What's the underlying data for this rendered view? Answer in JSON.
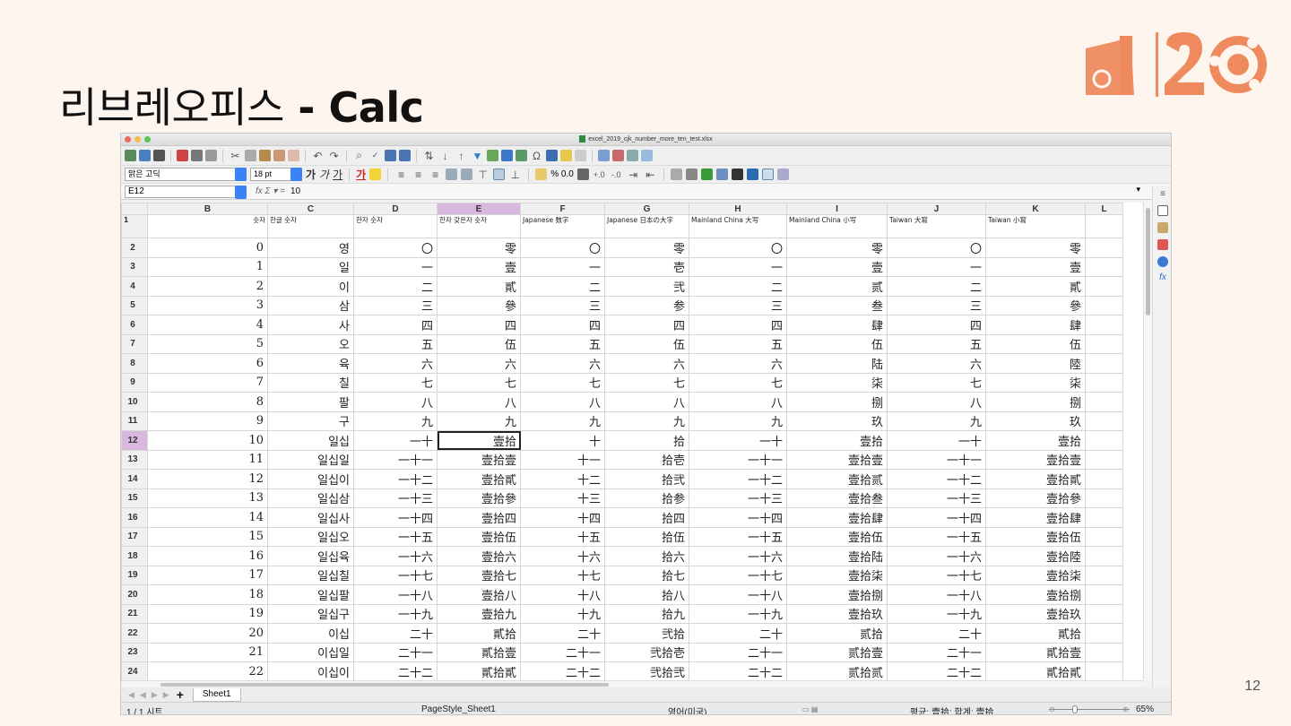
{
  "slide": {
    "title_korean": "리브레오피스",
    "title_dash": " - ",
    "title_app": "Calc",
    "page_number": "12"
  },
  "window": {
    "title": "excel_2019_cjk_number_more_ten_test.xlsx",
    "font_name": "맑은 고딕",
    "font_size": "18 pt",
    "name_box": "E12",
    "formula_icons": "fx Σ ▾ =",
    "formula_value": "10",
    "number_format": "% 0.0"
  },
  "columns": [
    "B",
    "C",
    "D",
    "E",
    "F",
    "G",
    "H",
    "I",
    "J",
    "K",
    "L"
  ],
  "header_row": {
    "row_num": "1",
    "cells": [
      "숫자",
      "한글 숫자",
      "한자 숫자",
      "한자 갖은자 숫자",
      "Japanese 数字",
      "Japanese 日本の大字",
      "Mainland China 大写",
      "Mainland China 小写",
      "Taiwan 大寫",
      "Taiwan 小寫",
      ""
    ]
  },
  "rows": [
    {
      "n": "2",
      "cells": [
        "0",
        "영",
        "〇",
        "零",
        "〇",
        "零",
        "〇",
        "零",
        "〇",
        "零",
        ""
      ]
    },
    {
      "n": "3",
      "cells": [
        "1",
        "일",
        "一",
        "壹",
        "一",
        "壱",
        "一",
        "壹",
        "一",
        "壹",
        ""
      ]
    },
    {
      "n": "4",
      "cells": [
        "2",
        "이",
        "二",
        "貳",
        "二",
        "弐",
        "二",
        "贰",
        "二",
        "貳",
        ""
      ]
    },
    {
      "n": "5",
      "cells": [
        "3",
        "삼",
        "三",
        "參",
        "三",
        "参",
        "三",
        "叁",
        "三",
        "參",
        ""
      ]
    },
    {
      "n": "6",
      "cells": [
        "4",
        "사",
        "四",
        "四",
        "四",
        "四",
        "四",
        "肆",
        "四",
        "肆",
        ""
      ]
    },
    {
      "n": "7",
      "cells": [
        "5",
        "오",
        "五",
        "伍",
        "五",
        "伍",
        "五",
        "伍",
        "五",
        "伍",
        ""
      ]
    },
    {
      "n": "8",
      "cells": [
        "6",
        "육",
        "六",
        "六",
        "六",
        "六",
        "六",
        "陆",
        "六",
        "陸",
        ""
      ]
    },
    {
      "n": "9",
      "cells": [
        "7",
        "칠",
        "七",
        "七",
        "七",
        "七",
        "七",
        "柒",
        "七",
        "柒",
        ""
      ]
    },
    {
      "n": "10",
      "cells": [
        "8",
        "팔",
        "八",
        "八",
        "八",
        "八",
        "八",
        "捌",
        "八",
        "捌",
        ""
      ]
    },
    {
      "n": "11",
      "cells": [
        "9",
        "구",
        "九",
        "九",
        "九",
        "九",
        "九",
        "玖",
        "九",
        "玖",
        ""
      ]
    },
    {
      "n": "12",
      "cells": [
        "10",
        "일십",
        "一十",
        "壹拾",
        "十",
        "拾",
        "一十",
        "壹拾",
        "一十",
        "壹拾",
        ""
      ]
    },
    {
      "n": "13",
      "cells": [
        "11",
        "일십일",
        "一十一",
        "壹拾壹",
        "十一",
        "拾壱",
        "一十一",
        "壹拾壹",
        "一十一",
        "壹拾壹",
        ""
      ]
    },
    {
      "n": "14",
      "cells": [
        "12",
        "일십이",
        "一十二",
        "壹拾貳",
        "十二",
        "拾弐",
        "一十二",
        "壹拾贰",
        "一十二",
        "壹拾貳",
        ""
      ]
    },
    {
      "n": "15",
      "cells": [
        "13",
        "일십삼",
        "一十三",
        "壹拾參",
        "十三",
        "拾参",
        "一十三",
        "壹拾叁",
        "一十三",
        "壹拾參",
        ""
      ]
    },
    {
      "n": "16",
      "cells": [
        "14",
        "일십사",
        "一十四",
        "壹拾四",
        "十四",
        "拾四",
        "一十四",
        "壹拾肆",
        "一十四",
        "壹拾肆",
        ""
      ]
    },
    {
      "n": "17",
      "cells": [
        "15",
        "일십오",
        "一十五",
        "壹拾伍",
        "十五",
        "拾伍",
        "一十五",
        "壹拾伍",
        "一十五",
        "壹拾伍",
        ""
      ]
    },
    {
      "n": "18",
      "cells": [
        "16",
        "일십육",
        "一十六",
        "壹拾六",
        "十六",
        "拾六",
        "一十六",
        "壹拾陆",
        "一十六",
        "壹拾陸",
        ""
      ]
    },
    {
      "n": "19",
      "cells": [
        "17",
        "일십칠",
        "一十七",
        "壹拾七",
        "十七",
        "拾七",
        "一十七",
        "壹拾柒",
        "一十七",
        "壹拾柒",
        ""
      ]
    },
    {
      "n": "20",
      "cells": [
        "18",
        "일십팔",
        "一十八",
        "壹拾八",
        "十八",
        "拾八",
        "一十八",
        "壹拾捌",
        "一十八",
        "壹拾捌",
        ""
      ]
    },
    {
      "n": "21",
      "cells": [
        "19",
        "일십구",
        "一十九",
        "壹拾九",
        "十九",
        "拾九",
        "一十九",
        "壹拾玖",
        "一十九",
        "壹拾玖",
        ""
      ]
    },
    {
      "n": "22",
      "cells": [
        "20",
        "이십",
        "二十",
        "貳拾",
        "二十",
        "弐拾",
        "二十",
        "贰拾",
        "二十",
        "貳拾",
        ""
      ]
    },
    {
      "n": "23",
      "cells": [
        "21",
        "이십일",
        "二十一",
        "貳拾壹",
        "二十一",
        "弐拾壱",
        "二十一",
        "贰拾壹",
        "二十一",
        "貳拾壹",
        ""
      ]
    },
    {
      "n": "24",
      "cells": [
        "22",
        "이십이",
        "二十二",
        "貳拾貳",
        "二十二",
        "弐拾弐",
        "二十二",
        "贰拾贰",
        "二十二",
        "貳拾貳",
        ""
      ]
    }
  ],
  "active_row": "12",
  "active_col": "E",
  "sheet_tab": "Sheet1",
  "status": {
    "sheet_info": "1 / 1 시트",
    "page_style": "PageStyle_Sheet1",
    "language": "영어(미국)",
    "summary": "평균: 壹拾; 합계: 壹拾",
    "zoom": "65%"
  },
  "colors": {
    "background": "#fdf5ee",
    "logo": "#ef8a5e",
    "selection": "#d9b8e0"
  }
}
